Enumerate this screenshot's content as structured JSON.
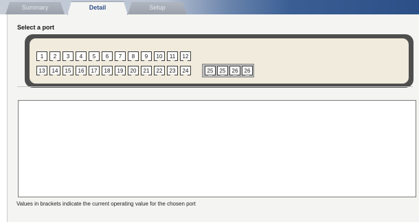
{
  "tabs": {
    "summary": "Summary",
    "detail": "Detail",
    "setup": "Setup"
  },
  "panel": {
    "section_title": "Select a port",
    "note": "Values in brackets indicate the current operating value for the chosen port"
  },
  "ports": {
    "row1": [
      "1",
      "2",
      "3",
      "4",
      "5",
      "6",
      "7",
      "8",
      "9",
      "10",
      "11",
      "12"
    ],
    "row2": [
      "13",
      "14",
      "15",
      "16",
      "17",
      "18",
      "19",
      "20",
      "21",
      "22",
      "23",
      "24"
    ],
    "sfp": [
      "25",
      "25",
      "26",
      "26"
    ]
  },
  "colors": {
    "tab_active_text": "#2d4d8a",
    "switch_frame": "#4e4e4e",
    "switch_face": "#f0ebdc"
  }
}
